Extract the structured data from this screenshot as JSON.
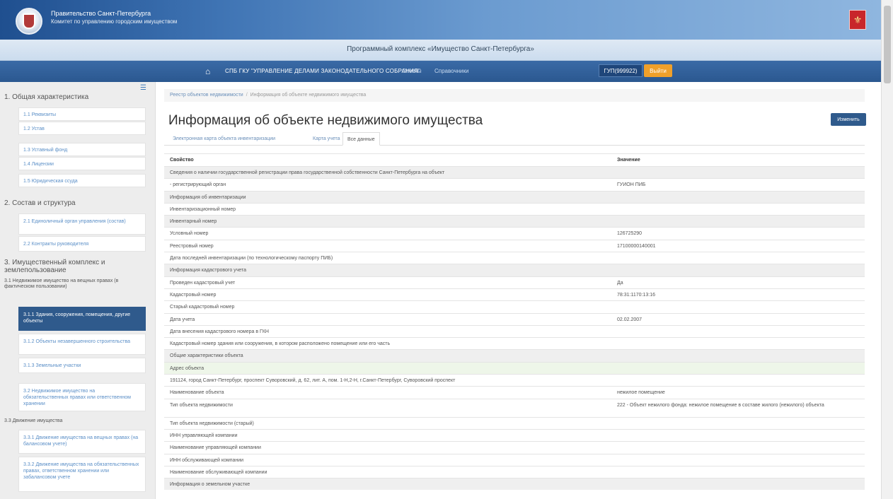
{
  "header": {
    "gov_line1": "Правительство Санкт-Петербурга",
    "gov_line2": "Комитет по управлению городским имуществом",
    "app_title": "Программный комплекс «Имущество Санкт-Петербурга»",
    "org_name": "СПБ ГКУ \"УПРАВЛЕНИЕ ДЕЛАМИ ЗАКОНОДАТЕЛЬНОГО СОБРАНИЯ\"",
    "nav_link_1": "Отчеты",
    "nav_link_2": "Справочники",
    "user_id": "ГУП(999922)",
    "exit_label": "Выйти",
    "colors": {
      "accent": "#2f5a8c",
      "exit": "#f0a02a",
      "emblem": "#c8262b"
    }
  },
  "sidebar": {
    "section1_title": "1. Общая характеристика",
    "section1_items": [
      "1.1 Реквизиты",
      "1.2 Устав",
      "1.3 Уставный фонд",
      "1.4 Лицензии",
      "1.5 Юридическая ссуда"
    ],
    "section2_title": "2. Состав и структура",
    "section2_items": [
      "2.1 Единоличный орган управления (состав)",
      "2.2 Контракты руководителя"
    ],
    "section3_title_l1": "3. Имущественный комплекс и",
    "section3_title_l2": "землепользование",
    "section31_title": "3.1 Недвижимое имущество на вещных правах (в фактическом пользовании)",
    "section31_items": [
      "3.1.1 Здания, сооружения, помещения, другие объекты",
      "3.1.2 Объекты незавершенного строительства",
      "3.1.3 Земельные участки"
    ],
    "section32_item": "3.2 Недвижимое имущество на обязательственных правах или ответственном хранении",
    "section33_title": "3.3 Движение имущества",
    "section33_items": [
      "3.3.1 Движение имущества на вещных правах (на балансовом учете)",
      "3.3.2 Движение имущества на обязательственных правах, ответственном хранении или забалансовом учете"
    ]
  },
  "main": {
    "breadcrumb_1": "Реестр объектов недвижимости",
    "breadcrumb_2": "Информация об объекте недвижимого имущества",
    "title": "Информация об объекте недвижимого имущества",
    "edit_label": "Изменить",
    "tabs": [
      "Электронная карта объекта инвентаризации",
      "Карта учета",
      "Все данные"
    ],
    "active_tab": "Все данные",
    "table_header": {
      "property": "Свойство",
      "value": "Значение"
    },
    "rows": [
      {
        "c1": "Сведения о наличии государственной регистрации права государственной собственности Санкт-Петербурга на объект",
        "c2": "",
        "kind": "grp"
      },
      {
        "c1": "- регистрирующий орган",
        "c2": "ГУИОН ПИБ",
        "kind": "n"
      },
      {
        "c1": "Информация об инвентаризации",
        "c2": "",
        "kind": "grp"
      },
      {
        "c1": "Инвентаризационный номер",
        "c2": "",
        "kind": "n"
      },
      {
        "c1": "Инвентарный номер",
        "c2": "",
        "kind": "grp"
      },
      {
        "c1": "Условный номер",
        "c2": "126725290",
        "kind": "n"
      },
      {
        "c1": "Реестровый номер",
        "c2": "17100000140001",
        "kind": "n"
      },
      {
        "c1": "Дата последней инвентаризации (по технологическому паспорту ПИБ)",
        "c2": "",
        "kind": "n"
      },
      {
        "c1": "Информация кадастрового учета",
        "c2": "",
        "kind": "grp"
      },
      {
        "c1": "Проведен кадастровый учет",
        "c2": "Да",
        "kind": "n"
      },
      {
        "c1": "Кадастровый номер",
        "c2": "78:31:1170:13:16",
        "kind": "n"
      },
      {
        "c1": "Старый кадастровый номер",
        "c2": "",
        "kind": "n"
      },
      {
        "c1": "Дата учета",
        "c2": "02.02.2007",
        "kind": "n"
      },
      {
        "c1": "Дата внесения кадастрового номера в ГКН",
        "c2": "",
        "kind": "n"
      },
      {
        "c1": "Кадастровый номер здания или сооружения, в котором расположено помещение или его часть",
        "c2": "",
        "kind": "n"
      },
      {
        "c1": "Общие характеристики объекта",
        "c2": "",
        "kind": "grp"
      },
      {
        "c1": "Адрес объекта",
        "c2": "",
        "kind": "hl"
      },
      {
        "c1": "191124, город Санкт-Петербург, проспект Суворовский, д. 62, лит. А, пом. 1-Н,2-Н, г.Санкт-Петербург, Суворовский проспект",
        "c2": "",
        "kind": "span"
      },
      {
        "c1": "Наименование объекта",
        "c2": "нежилое помещение",
        "kind": "n"
      },
      {
        "c1": "Тип объекта недвижимости",
        "c2": "222 - Объект нежилого фонда: нежилое помещение в составе жилого (нежилого) объекта",
        "kind": "tall"
      },
      {
        "c1": "Тип объекта недвижимости (старый)",
        "c2": "",
        "kind": "n"
      },
      {
        "c1": "ИНН управляющей компании",
        "c2": "",
        "kind": "n"
      },
      {
        "c1": "Наименование управляющей компании",
        "c2": "",
        "kind": "n"
      },
      {
        "c1": "ИНН обслуживающей компании",
        "c2": "",
        "kind": "n"
      },
      {
        "c1": "Наименование обслуживающей компании",
        "c2": "",
        "kind": "n"
      },
      {
        "c1": "Информация о земельном участке",
        "c2": "",
        "kind": "grp"
      }
    ]
  }
}
